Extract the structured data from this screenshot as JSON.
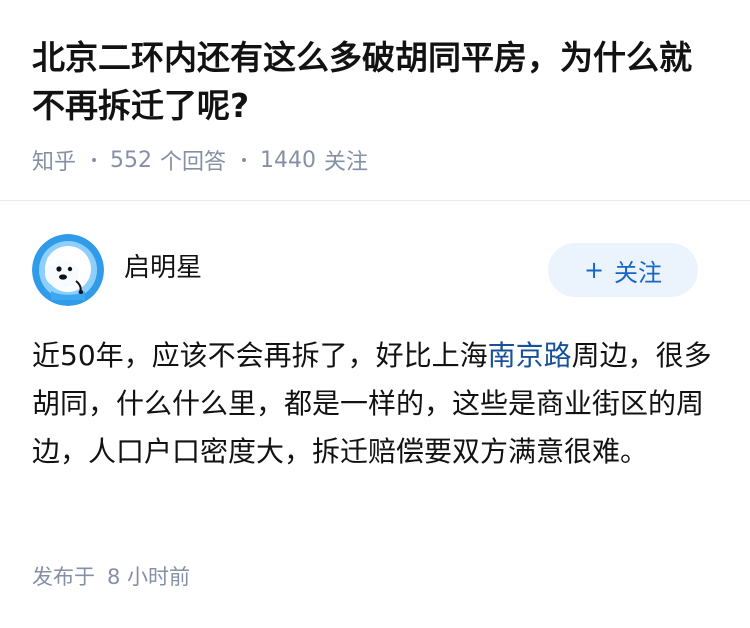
{
  "question": {
    "title": "北京二环内还有这么多破胡同平房，为什么就不再拆迁了呢?",
    "source": "知乎",
    "answer_count": "552",
    "answer_label": "个回答",
    "follower_count": "1440",
    "follower_label": "关注"
  },
  "answer": {
    "author": {
      "name": "启明星",
      "avatar_icon": "polar-bear-avatar-icon"
    },
    "follow_button": {
      "icon": "plus-icon",
      "plus": "+",
      "label": "关注"
    },
    "body": {
      "text_before_link": "近50年，应该不会再拆了，好比上海",
      "link_text": "南京路",
      "text_after_link": "周边，很多胡同，什么什么里，都是一样的，这些是商业街区的周边，人口户口密度大，拆迁赔偿要双方满意很难。"
    },
    "published": {
      "label": "发布于",
      "time": "8 小时前"
    }
  },
  "colors": {
    "title_text": "#121212",
    "meta_gray": "#8590a6",
    "follow_bg": "#ebf4fc",
    "follow_text": "#1766c7",
    "link_blue": "#175199",
    "avatar_bg": "#2f9be9"
  }
}
